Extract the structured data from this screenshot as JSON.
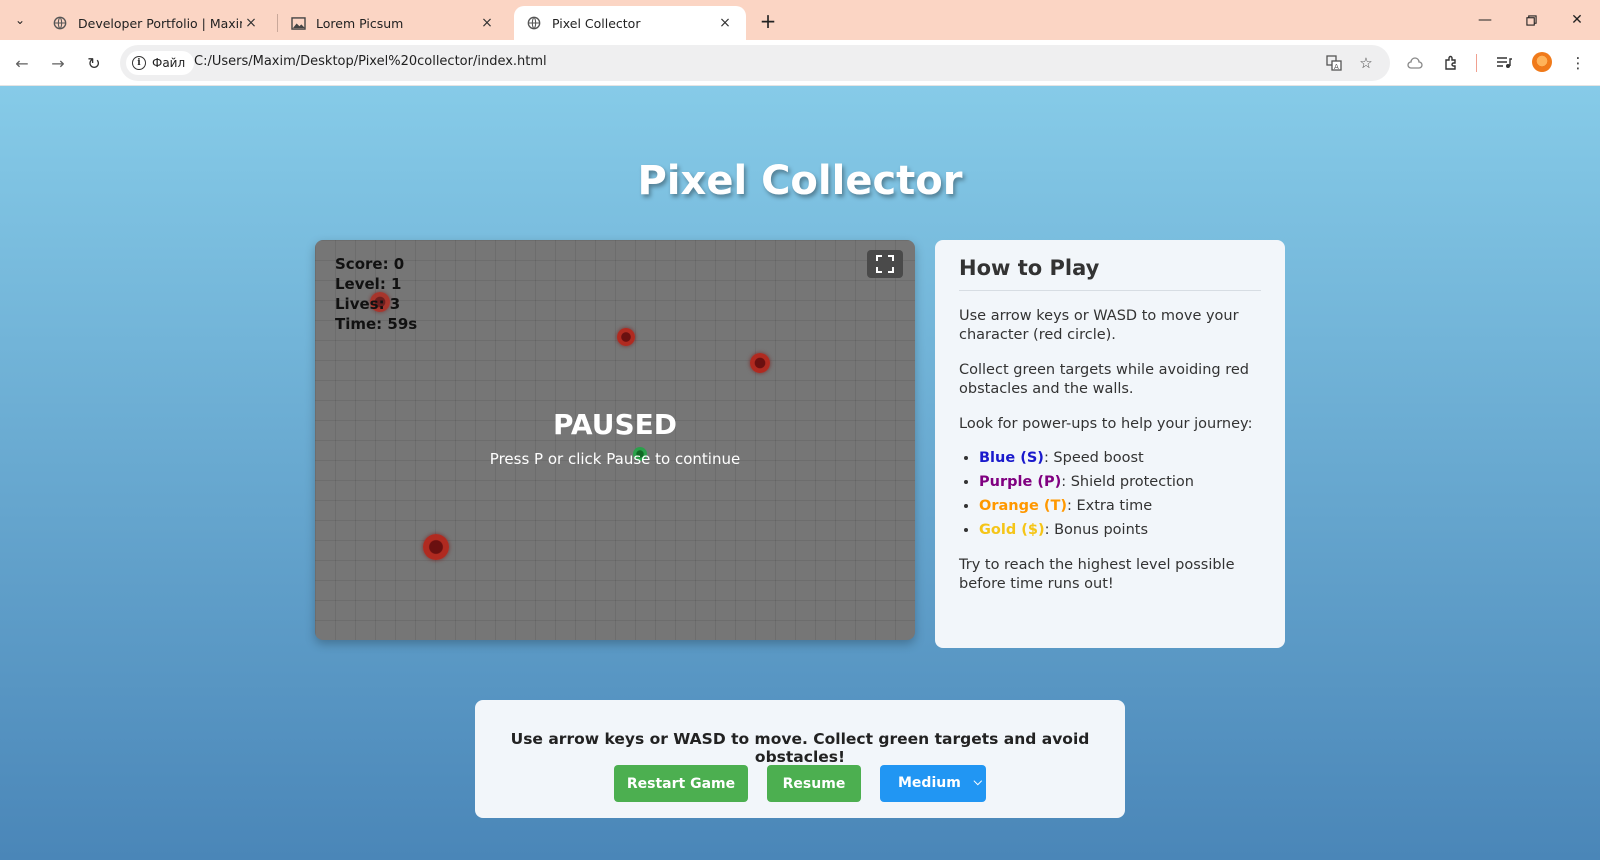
{
  "browser": {
    "tabs": [
      {
        "title": "Developer Portfolio | Maxim Mk",
        "active": false
      },
      {
        "title": "Lorem Picsum",
        "active": false
      },
      {
        "title": "Pixel Collector",
        "active": true
      }
    ],
    "site_chip_label": "Файл",
    "url": "C:/Users/Maxim/Desktop/Pixel%20collector/index.html"
  },
  "page": {
    "title": "Pixel Collector"
  },
  "game": {
    "hud": {
      "score": "Score: 0",
      "level": "Level: 1",
      "lives": "Lives: 3",
      "time": "Time: 59s"
    },
    "paused_title": "PAUSED",
    "paused_subtitle": "Press P or click Pause to continue"
  },
  "howto": {
    "heading": "How to Play",
    "p1": "Use arrow keys or WASD to move your character (red circle).",
    "p2": "Collect green targets while avoiding red obstacles and the walls.",
    "p3": "Look for power-ups to help your journey:",
    "powerups": [
      {
        "name": "Blue (S)",
        "desc": ": Speed boost",
        "color": "#1a1acc"
      },
      {
        "name": "Purple (P)",
        "desc": ": Shield protection",
        "color": "#800080"
      },
      {
        "name": "Orange (T)",
        "desc": ": Extra time",
        "color": "#ff9800"
      },
      {
        "name": "Gold ($)",
        "desc": ": Bonus points",
        "color": "#f5c518"
      }
    ],
    "p4": "Try to reach the highest level possible before time runs out!"
  },
  "controls": {
    "instructions": "Use arrow keys or WASD to move. Collect green targets and avoid obstacles!",
    "restart_label": "Restart Game",
    "resume_label": "Resume",
    "difficulty_value": "Medium"
  },
  "colors": {
    "button_green": "#4caf50",
    "select_blue": "#2196f3"
  }
}
